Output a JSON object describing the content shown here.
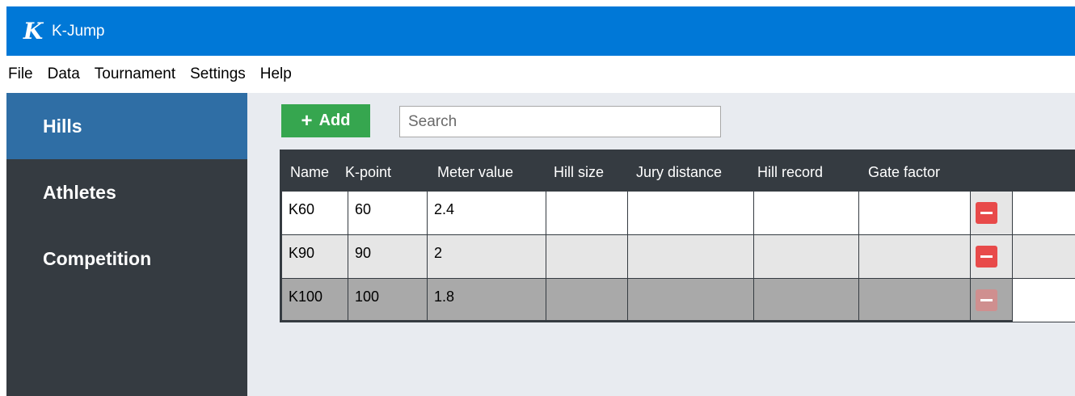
{
  "window": {
    "title": "K-Jump",
    "logo_letter": "K"
  },
  "menu": [
    "File",
    "Data",
    "Tournament",
    "Settings",
    "Help"
  ],
  "sidebar": {
    "items": [
      {
        "label": "Hills",
        "active": true
      },
      {
        "label": "Athletes",
        "active": false
      },
      {
        "label": "Competition",
        "active": false
      }
    ]
  },
  "toolbar": {
    "add_label": "Add",
    "search_placeholder": "Search"
  },
  "table": {
    "columns": [
      "Name",
      "K-point",
      "Meter value",
      "Hill size",
      "Jury distance",
      "Hill record",
      "Gate factor"
    ],
    "rows": [
      [
        "K60",
        "60",
        "2.4",
        "",
        "",
        "",
        ""
      ],
      [
        "K90",
        "90",
        "2",
        "",
        "",
        "",
        ""
      ],
      [
        "K100",
        "100",
        "1.8",
        "",
        "",
        "",
        ""
      ]
    ]
  },
  "colors": {
    "titlebar": "#0078d7",
    "sidebar": "#353b41",
    "sidebar_active": "#2f6ea5",
    "add_button": "#36a64f",
    "remove_button": "#e84a4a",
    "row_white": "#ffffff",
    "row_light": "#e6e6e6",
    "row_selected": "#a9a9a9"
  },
  "icons": {
    "add": "plus-icon",
    "remove": "minus-icon"
  }
}
